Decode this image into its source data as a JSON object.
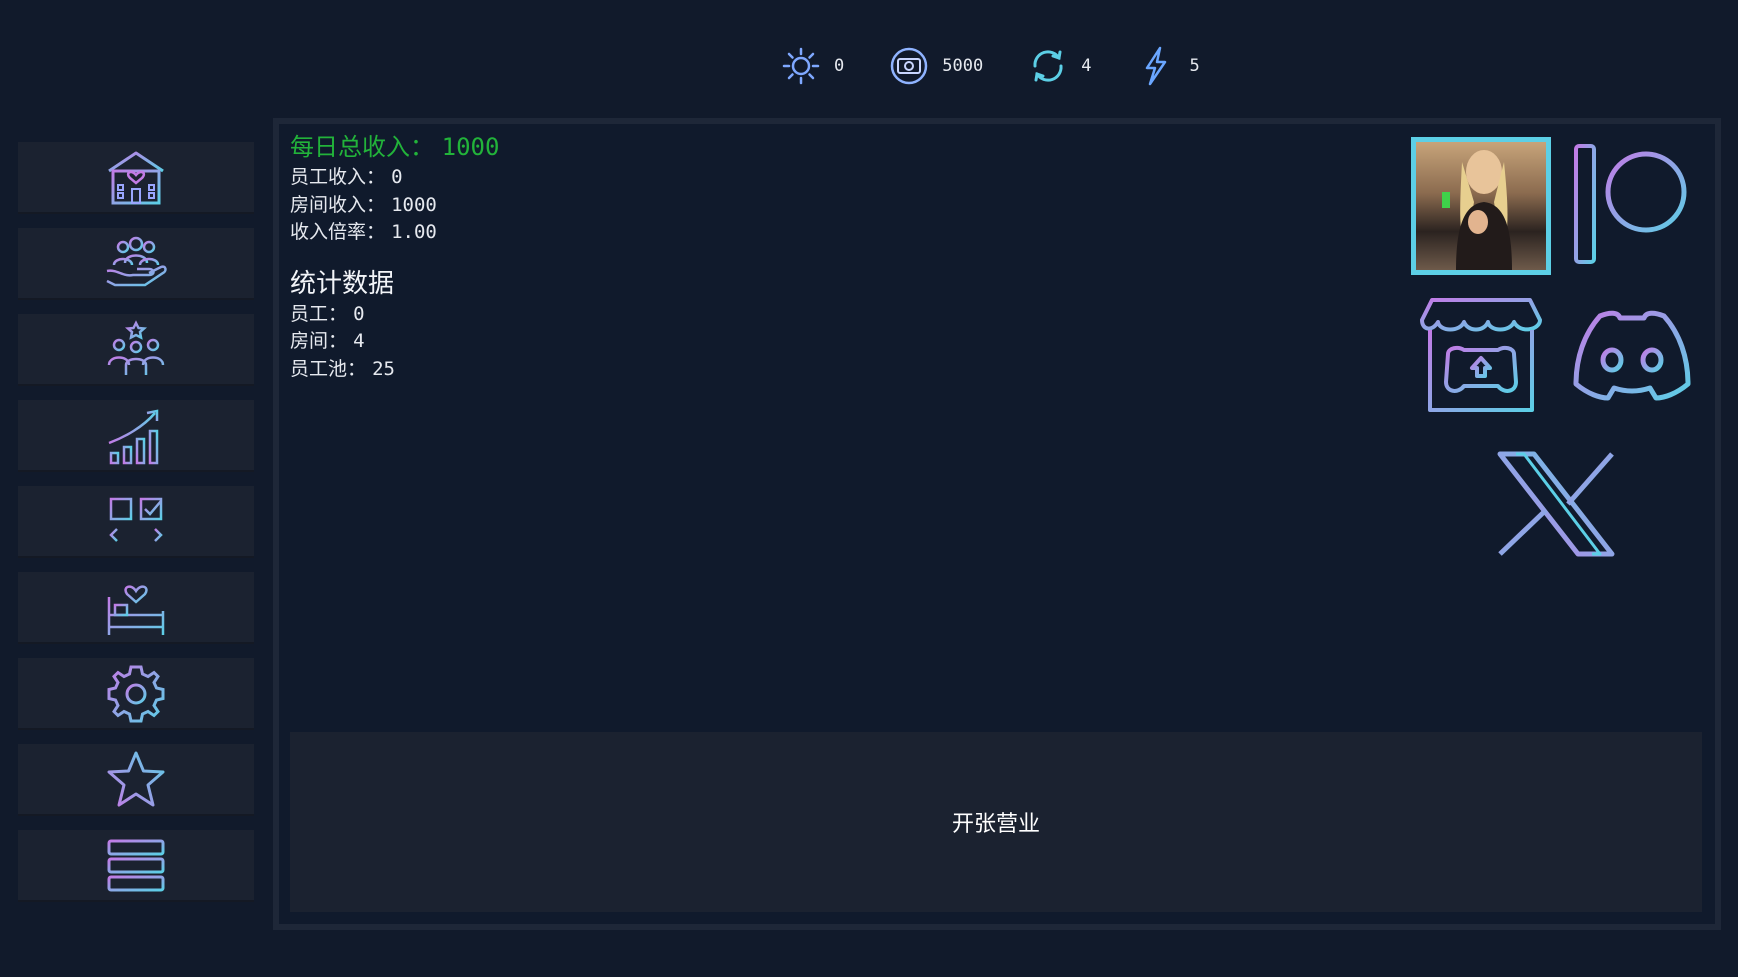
{
  "resources": {
    "reputation": "0",
    "money": "5000",
    "turns": "4",
    "energy": "5"
  },
  "income": {
    "total_label": "每日总收入：",
    "total_value": "1000",
    "staff_label": "员工收入：",
    "staff_value": "0",
    "room_label": "房间收入：",
    "room_value": "1000",
    "multiplier_label": "收入倍率：",
    "multiplier_value": "1.00"
  },
  "statistics": {
    "title": "统计数据",
    "staff_label": "员工：",
    "staff_value": "0",
    "rooms_label": "房间：",
    "rooms_value": "4",
    "pool_label": "员工池：",
    "pool_value": "25"
  },
  "open_business_label": "开张营业",
  "icons": {
    "sidebar": [
      "house-heart-icon",
      "staff-hand-icon",
      "team-star-icon",
      "growth-chart-icon",
      "checklist-swap-icon",
      "bed-heart-icon",
      "gear-icon",
      "star-icon",
      "menu-icon"
    ],
    "social": [
      "patreon-icon",
      "itch-io-icon",
      "discord-icon",
      "x-twitter-icon"
    ]
  },
  "colors": {
    "accent_cyan": "#5ccfe6",
    "accent_purple": "#c27be6",
    "income_green": "#22b33a",
    "background": "#111a2b",
    "button_bg": "#1b2230"
  }
}
